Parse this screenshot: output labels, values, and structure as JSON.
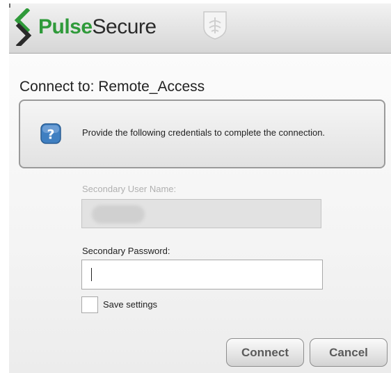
{
  "header": {
    "brand_pulse": "Pulse",
    "brand_secure": "Secure",
    "logo_icon": "pulse-secure-logo-icon",
    "shield_icon": "shield-emblem-icon"
  },
  "dialog": {
    "connect_to": "Connect to: Remote_Access",
    "info_text": "Provide the following credentials to complete the connection.",
    "info_icon": "help-question-icon",
    "secondary_username_label": "Secondary User Name:",
    "secondary_username_value": "",
    "secondary_password_label": "Secondary Password:",
    "secondary_password_value": "",
    "save_settings_label": "Save settings",
    "save_settings_checked": false,
    "connect_button": "Connect",
    "cancel_button": "Cancel"
  },
  "colors": {
    "brand_green": "#2f9a3a",
    "help_blue": "#3f7fc1"
  }
}
